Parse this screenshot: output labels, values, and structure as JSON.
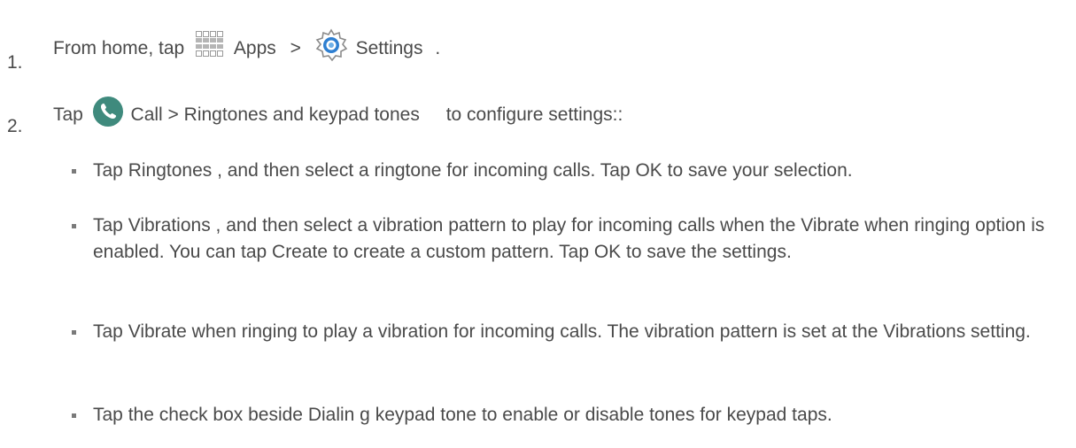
{
  "steps": [
    {
      "number": "1.",
      "prefix": "From home, tap",
      "apps_label": "Apps",
      "separator": ">",
      "settings_label": "Settings",
      "suffix": ".",
      "apps_icon": "apps-grid-icon",
      "settings_icon": "settings-gear-icon"
    },
    {
      "number": "2.",
      "prefix": "Tap",
      "call_label": "Call > Ringtones and keypad tones",
      "suffix": "to configure settings::",
      "call_icon": "phone-call-icon"
    }
  ],
  "bullets": [
    "Tap Ringtones , and then select a ringtone for incoming calls. Tap OK to save your selection.",
    "Tap Vibrations , and then select a vibration pattern to play for incoming calls when the Vibrate when ringing option is enabled. You can tap Create to create a custom pattern. Tap OK to save the settings.",
    "Tap Vibrate when ringing   to play a vibration for incoming calls. The vibration pattern is set at the Vibrations setting.",
    "Tap the check box beside Dialin g keypad tone  to enable or disable tones for keypad taps."
  ],
  "colors": {
    "text": "#4a4a4a",
    "call_icon_bg": "#3f8a7d",
    "settings_ring": "#8a8a8a",
    "settings_center": "#2e7fd1"
  }
}
